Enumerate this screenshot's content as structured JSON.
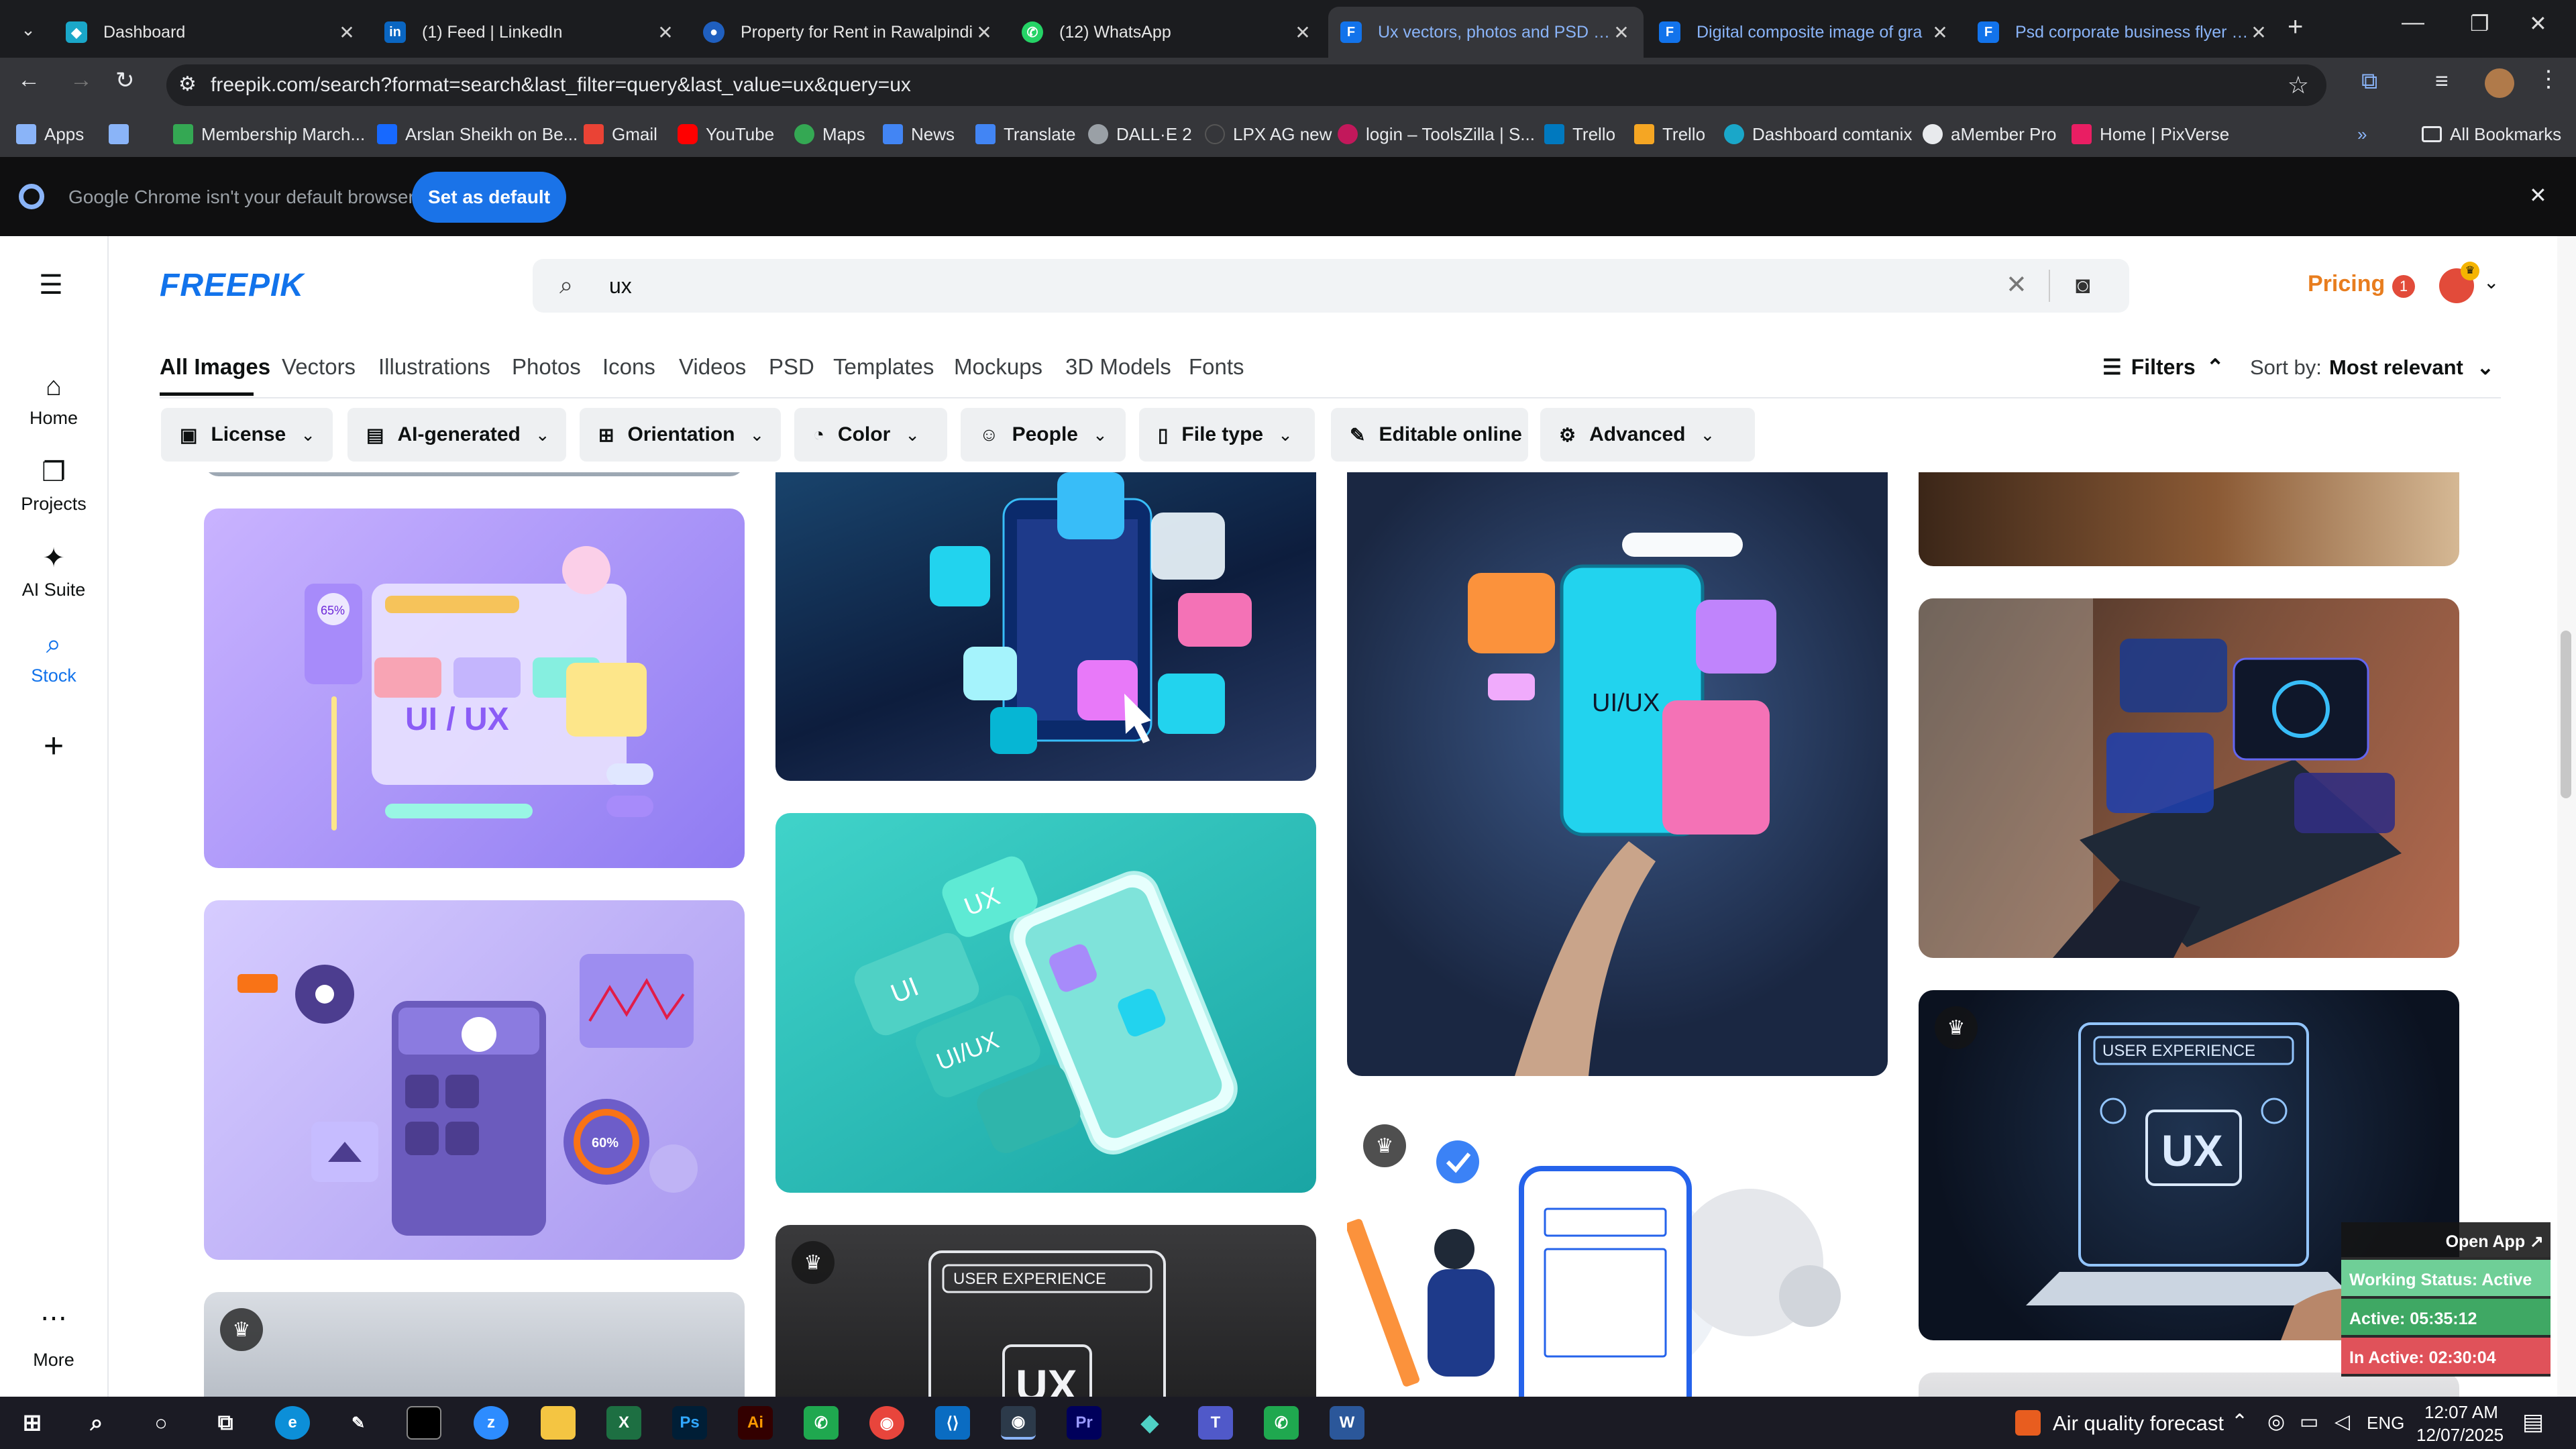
{
  "browser": {
    "tabs": [
      {
        "title": "Dashboard",
        "icon": "dashboard-tab-icon",
        "color": "#1aa7c9"
      },
      {
        "title": "(1) Feed | LinkedIn",
        "icon": "linkedin-icon",
        "color": "#0a66c2"
      },
      {
        "title": "Property for Rent in Rawalpindi",
        "icon": "property-site-icon",
        "color": "#1f5fbf"
      },
      {
        "title": "(12) WhatsApp",
        "icon": "whatsapp-icon",
        "color": "#25d366"
      },
      {
        "title": "Ux vectors, photos and PSD files",
        "icon": "freepik-tab-icon",
        "color": "#1273eb"
      },
      {
        "title": "Digital composite image of gra",
        "icon": "freepik-tab-icon",
        "color": "#1273eb"
      },
      {
        "title": "Psd corporate business flyer de",
        "icon": "freepik-tab-icon",
        "color": "#1273eb"
      }
    ],
    "url": "freepik.com/search?format=search&last_filter=query&last_value=ux&query=ux",
    "bookmarks": [
      {
        "label": "Apps",
        "color": "#8ab4f8"
      },
      {
        "label": "",
        "color": "#8ab4f8"
      },
      {
        "label": "Membership March...",
        "color": "#34a853"
      },
      {
        "label": "Arslan Sheikh on Be...",
        "color": "#1769ff"
      },
      {
        "label": "Gmail",
        "color": "#ea4335"
      },
      {
        "label": "YouTube",
        "color": "#ff0000"
      },
      {
        "label": "Maps",
        "color": "#34a853"
      },
      {
        "label": "News",
        "color": "#4285f4"
      },
      {
        "label": "Translate",
        "color": "#4285f4"
      },
      {
        "label": "DALL·E 2",
        "color": "#9aa0a6"
      },
      {
        "label": "LPX AG new",
        "color": "#35363a"
      },
      {
        "label": "login – ToolsZilla | S...",
        "color": "#c2185b"
      },
      {
        "label": "Trello",
        "color": "#0079bf"
      },
      {
        "label": "Trello",
        "color": "#f5a623"
      },
      {
        "label": "Dashboard comtanix",
        "color": "#1aa7c9"
      },
      {
        "label": "aMember Pro",
        "color": "#e8eaed"
      },
      {
        "label": "Home | PixVerse",
        "color": "#e91e63"
      }
    ],
    "all_bookmarks": "All Bookmarks",
    "infobar": {
      "message": "Google Chrome isn't your default browser",
      "button": "Set as default"
    }
  },
  "sidebar": {
    "items": [
      {
        "label": "Home",
        "icon": "home-icon"
      },
      {
        "label": "Projects",
        "icon": "projects-icon"
      },
      {
        "label": "AI Suite",
        "icon": "ai-suite-icon"
      },
      {
        "label": "Stock",
        "icon": "stock-icon"
      }
    ],
    "add": "+",
    "more": "More"
  },
  "header": {
    "logo": "FREEPIK",
    "search_value": "ux",
    "pricing": "Pricing",
    "notification_count": "1"
  },
  "categories": [
    "All Images",
    "Vectors",
    "Illustrations",
    "Photos",
    "Icons",
    "Videos",
    "PSD",
    "Templates",
    "Mockups",
    "3D Models",
    "Fonts"
  ],
  "filters_label": "Filters",
  "sort_label": "Sort by:",
  "sort_value": "Most relevant",
  "filter_buttons": [
    "License",
    "AI-generated",
    "Orientation",
    "Color",
    "People",
    "File type",
    "Editable online",
    "Advanced"
  ],
  "image_text": {
    "uiux": "UI / UX",
    "rating": "65%",
    "percent60": "60%",
    "ui": "UI",
    "ux": "UX",
    "uiux2": "UI/UX",
    "phone_uiux": "UI/UX",
    "user_experience": "USER EXPERIENCE",
    "ux_big": "UX"
  },
  "widget": {
    "open_app": "Open App ↗",
    "working": "Working Status: Active",
    "active": "Active: 05:35:12",
    "inactive": "In Active: 02:30:04"
  },
  "taskbar": {
    "weather": "Air quality forecast",
    "lang": "ENG",
    "time": "12:07 AM",
    "date": "12/07/2025"
  }
}
